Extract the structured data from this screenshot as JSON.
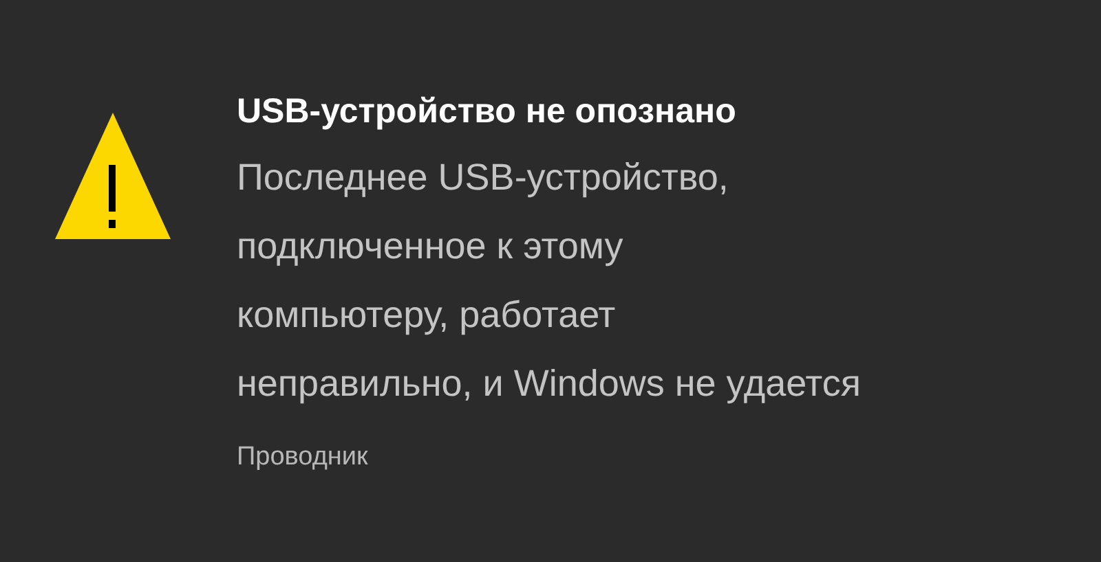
{
  "notification": {
    "title": "USB-устройство не опознано",
    "body_lines": [
      "Последнее USB-устройство,",
      "подключенное к этому",
      "компьютеру, работает",
      "неправильно, и Windows не удается"
    ],
    "source": "Проводник"
  }
}
